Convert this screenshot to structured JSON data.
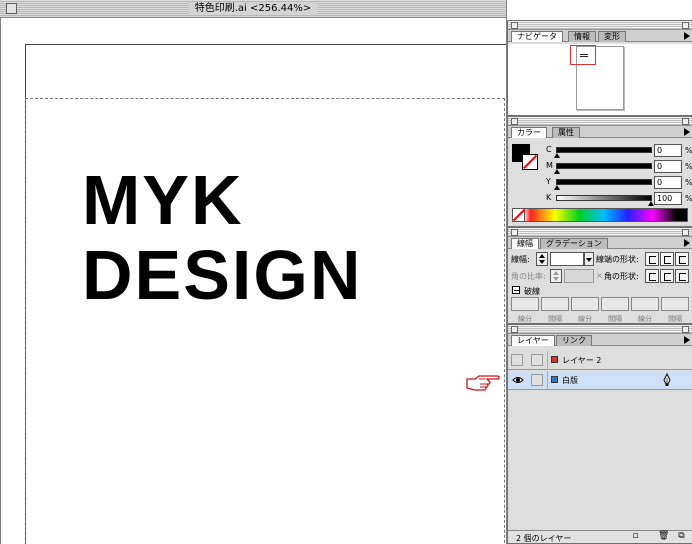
{
  "window": {
    "title": "特色印刷.ai <256.44%>"
  },
  "artwork": {
    "line1": "MYK",
    "line2": "DESIGN"
  },
  "navigator_palette": {
    "tabs": [
      "ナビゲータ",
      "情報",
      "変形"
    ],
    "active_tab": 0
  },
  "color_palette": {
    "tabs": [
      "カラー",
      "属性"
    ],
    "active_tab": 0,
    "channels": [
      {
        "label": "C",
        "value": "0",
        "unit": "%"
      },
      {
        "label": "M",
        "value": "0",
        "unit": "%"
      },
      {
        "label": "Y",
        "value": "0",
        "unit": "%"
      },
      {
        "label": "K",
        "value": "100",
        "unit": "%"
      }
    ],
    "fill_color": "#000000",
    "stroke_color": "none"
  },
  "stroke_palette": {
    "tabs": [
      "線幅",
      "グラデーション"
    ],
    "active_tab": 0,
    "weight_label": "線幅:",
    "weight_value": "",
    "cap_label": "線端の形状:",
    "miter_label": "角の比率:",
    "miter_value": "",
    "miter_x": "×",
    "join_label": "角の形状:",
    "dashed_label": "破線",
    "dash_labels": [
      "線分",
      "間隔",
      "線分",
      "間隔",
      "線分",
      "間隔"
    ]
  },
  "layers_palette": {
    "tabs": [
      "レイヤー",
      "リンク"
    ],
    "active_tab": 0,
    "layers": [
      {
        "name": "レイヤー 2",
        "color": "#e03020",
        "visible": false,
        "selected": false
      },
      {
        "name": "白版",
        "color": "#2878d0",
        "visible": true,
        "selected": true
      }
    ],
    "count_text": "2 個のレイヤー"
  },
  "cursor": {
    "icon": "pointing-hand-icon",
    "color": "#d01010"
  }
}
